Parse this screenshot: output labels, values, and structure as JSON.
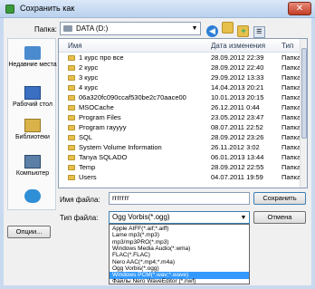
{
  "window": {
    "title": "Сохранить как",
    "close": "✕"
  },
  "toolbar": {
    "folder_label": "Папка:",
    "folder_value": "DATA (D:)",
    "icons": [
      "back-arrow-icon",
      "up-folder-icon",
      "new-folder-icon",
      "view-menu-icon"
    ]
  },
  "places": [
    {
      "label": "Недавние места",
      "icon": "recent-places-icon"
    },
    {
      "label": "Рабочий стол",
      "icon": "desktop-icon"
    },
    {
      "label": "Библиотеки",
      "icon": "libraries-icon"
    },
    {
      "label": "Компьютер",
      "icon": "computer-icon"
    },
    {
      "label": "",
      "icon": "network-icon"
    }
  ],
  "filelist": {
    "columns": [
      "Имя",
      "Дата изменения",
      "Тип"
    ],
    "rows": [
      {
        "name": "1 курс про все",
        "date": "28.09.2012 22:39",
        "type": "Папка"
      },
      {
        "name": "2 курс",
        "date": "28.09.2012 22:40",
        "type": "Папка"
      },
      {
        "name": "3 курс",
        "date": "29.09.2012 13:33",
        "type": "Папка"
      },
      {
        "name": "4 курс",
        "date": "14.04.2013 20:21",
        "type": "Папка"
      },
      {
        "name": "06a320fc090ccaf530be2c70aace00",
        "date": "10.01.2013 20:15",
        "type": "Папка"
      },
      {
        "name": "MSOCache",
        "date": "26.12.2011 0:44",
        "type": "Папка"
      },
      {
        "name": "Program Files",
        "date": "23.05.2012 23:47",
        "type": "Папка"
      },
      {
        "name": "Program rayyyy",
        "date": "08.07.2011 22:52",
        "type": "Папка"
      },
      {
        "name": "SQL",
        "date": "28.09.2012 23:26",
        "type": "Папка"
      },
      {
        "name": "System Volume Information",
        "date": "26.11.2012 3:02",
        "type": "Папка"
      },
      {
        "name": "Tanya SQLADO",
        "date": "06.01.2013 13:44",
        "type": "Папка"
      },
      {
        "name": "Temp",
        "date": "28.09.2012 22:55",
        "type": "Папка"
      },
      {
        "name": "Users",
        "date": "04.07.2011 19:59",
        "type": "Папка"
      }
    ]
  },
  "form": {
    "filename_label": "Имя файла:",
    "filename_value": "rrrrrrr",
    "filetype_label": "Тип файла:",
    "filetype_value": "Ogg Vorbis(*.ogg)",
    "save_button": "Сохранить",
    "cancel_button": "Отмена",
    "options_button": "Опции..."
  },
  "dropdown": {
    "options": [
      "Apple AIFF(*.aif;*.aiff)",
      "Lame mp3(*.mp3)",
      "mp3/mp3PRO(*.mp3)",
      "Windows Media Audio(*.wma)",
      "FLAC(*.FLAC)",
      "Nero AAC(*.mp4;*.m4a)",
      "Ogg Vorbis(*.ogg)",
      "Windows PCM(*.wav;*.wave)",
      "Файлы Nero WaveEditor (*.nwf)"
    ],
    "selected_index": 7
  }
}
